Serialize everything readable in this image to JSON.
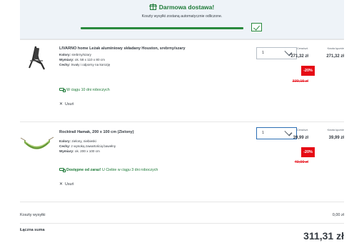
{
  "shipping_banner": {
    "title": "Darmowa dostawa!",
    "subtitle": "Koszty wysyłki zostaną automatycznie odliczone.",
    "progress_fraction": 1.0
  },
  "columns": {
    "unit_price": "Cena/szt.",
    "line_total": "Kwota łącznie"
  },
  "items": [
    {
      "name": "LIVARNO home Leżak aluminiowy składany Houston, srebrny/szary",
      "attributes": [
        {
          "label": "Kolory:",
          "value": "srebrny/szary"
        },
        {
          "label": "Wymiary:",
          "value": "ok. 58 x 110 x 80 cm"
        },
        {
          "label": "Cechy:",
          "value": "trwały i odporny na korozję"
        }
      ],
      "delivery_strong": "",
      "delivery_text": "W ciągu 10 dni roboczych",
      "remove_label": "Usuń",
      "quantity": "1",
      "unit_price": "271,32 zł",
      "line_total": "271,32 zł",
      "discount": "-20%",
      "old_price": "339,15 zł"
    },
    {
      "name": "Rocktrail Hamak, 200 x 100 cm (Zielony)",
      "attributes": [
        {
          "label": "Kolory:",
          "value": "zielony, niebieski"
        },
        {
          "label": "Cechy:",
          "value": "z wysoką zawartością bawełny"
        },
        {
          "label": "Wymiary:",
          "value": "ok. 200 x 100 cm"
        }
      ],
      "delivery_strong": "Dostępne od zaraz!",
      "delivery_text": "U Ciebie w ciągu 3 dni roboczych",
      "remove_label": "Usuń",
      "quantity": "1",
      "unit_price": "39,99 zł",
      "line_total": "39,99 zł",
      "discount": "-20%",
      "old_price": "49,99 zł"
    }
  ],
  "summary": {
    "shipping_label": "Koszty wysyłki",
    "shipping_value": "0,00 zł",
    "total_label": "Łączna suma",
    "total_value": "311,31 zł"
  },
  "colors": {
    "accent_green": "#1d7a37",
    "discount_red": "#e60a14",
    "banner_bg": "#eef3f8"
  }
}
